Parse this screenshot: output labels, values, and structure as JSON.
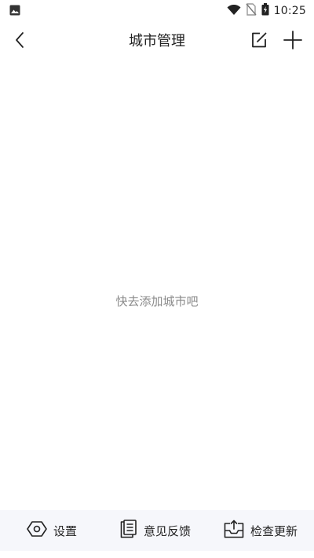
{
  "status_bar": {
    "time": "10:25",
    "icons": [
      "image-icon",
      "wifi-icon",
      "no-sim-icon",
      "battery-icon"
    ]
  },
  "header": {
    "title": "城市管理",
    "back_icon": "chevron-left-icon",
    "edit_icon": "edit-icon",
    "add_icon": "plus-icon"
  },
  "main": {
    "empty_text": "快去添加城市吧"
  },
  "bottom_bar": {
    "settings_label": "设置",
    "feedback_label": "意见反馈",
    "update_label": "检查更新"
  },
  "colors": {
    "bottom_bar_bg": "#f6f7fb",
    "empty_text": "#8a8a8a",
    "text": "#222222"
  }
}
